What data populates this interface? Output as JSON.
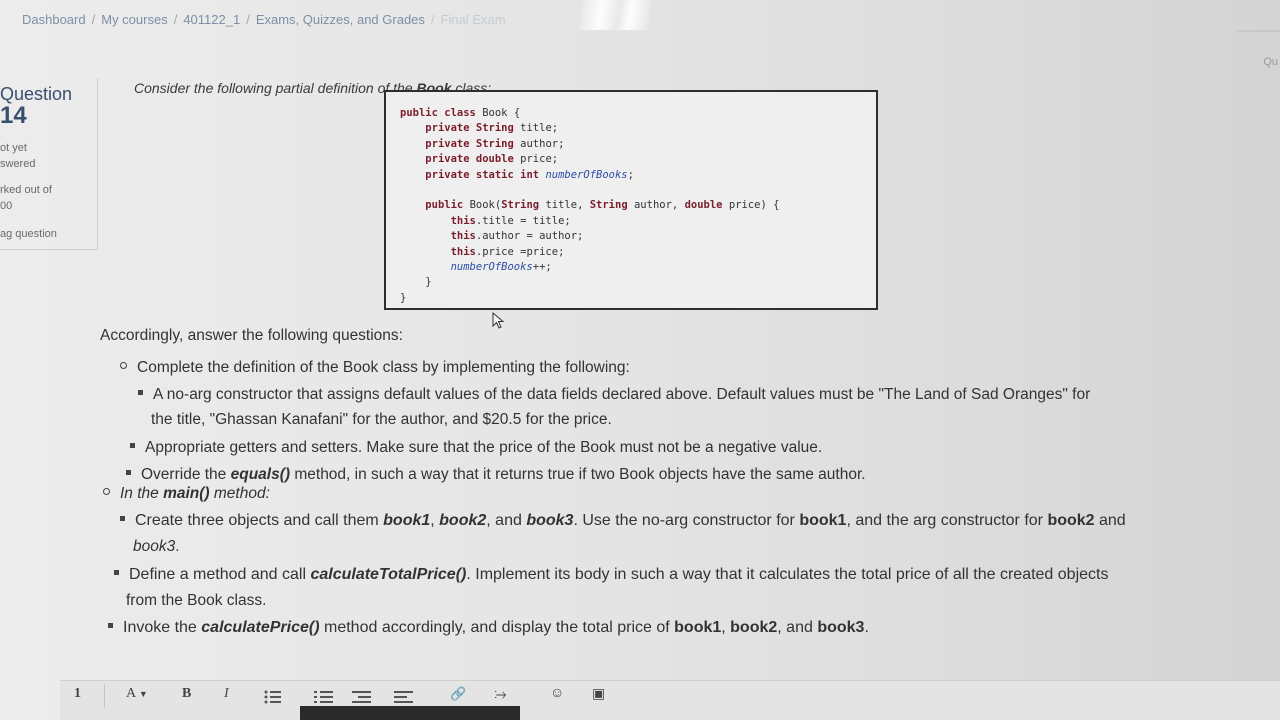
{
  "breadcrumb": {
    "items": [
      "Dashboard",
      "My courses",
      "401122_1",
      "Exams, Quizzes, and Grades",
      "Final Exam"
    ]
  },
  "top_right": {
    "label": "Qu"
  },
  "question_info": {
    "label": "Question",
    "number": "14",
    "status_line1": "ot yet",
    "status_line2": "swered",
    "marked_label": "rked out of",
    "marked_value": "00",
    "flag_label": "ag question"
  },
  "question": {
    "intro_prefix": "Consider the following partial definition of the ",
    "intro_class": "Book",
    "intro_suffix": " class:",
    "code_lines": [
      "public class Book {",
      "    private String title;",
      "    private String author;",
      "    private double price;",
      "    private static int numberOfBooks;",
      "",
      "    public Book(String title, String author, double price) {",
      "        this.title = title;",
      "        this.author = author;",
      "        this.price =price;",
      "        numberOfBooks++;",
      "    }",
      "}"
    ],
    "answer_intro": "Accordingly, answer the following questions:",
    "task1": "Complete the definition of the Book class by implementing the following:",
    "task1_a_line1": "A no-arg constructor that assigns default values of the data fields declared above. Default values must be \"The Land of Sad Oranges\" for",
    "task1_a_line2": "the title, \"Ghassan Kanafani\" for the author, and $20.5 for the price.",
    "task1_b": "Appropriate getters and setters. Make sure that the price of the Book must not be a negative value.",
    "task1_c_prefix": "Override the ",
    "task1_c_method": "equals()",
    "task1_c_suffix": " method, in such a way that it returns true if two Book objects have the same author.",
    "task2_prefix": "In the ",
    "task2_method": "main()",
    "task2_suffix": " method:",
    "task2_a_p1": "Create three objects and call them ",
    "task2_a_b1": "book1",
    "task2_a_s1": ", ",
    "task2_a_b2": "book2",
    "task2_a_s2": ", and ",
    "task2_a_b3": "book3",
    "task2_a_p2": ". Use the no-arg constructor for ",
    "task2_a_b4": "book1",
    "task2_a_p3": ", and the arg constructor for ",
    "task2_a_b5": "book2",
    "task2_a_p4": " and",
    "task2_a_line2": "book3",
    "task2_a_line2_end": ".",
    "task2_b_p1": "Define a method and call ",
    "task2_b_method": "calculateTotalPrice()",
    "task2_b_p2": ". Implement its body in such a way that it calculates the total price of all the created objects",
    "task2_b_line2": "from the Book class.",
    "task2_c_p1": "Invoke the ",
    "task2_c_method": "calculatePrice()",
    "task2_c_p2": " method accordingly, and display the total price of ",
    "task2_c_b1": "book1",
    "task2_c_s1": ", ",
    "task2_c_b2": "book2",
    "task2_c_s2": ", and ",
    "task2_c_b3": "book3",
    "task2_c_end": "."
  },
  "toolbar": {
    "item1": "1",
    "font_size": "A",
    "bold": "B",
    "italic": "I"
  }
}
